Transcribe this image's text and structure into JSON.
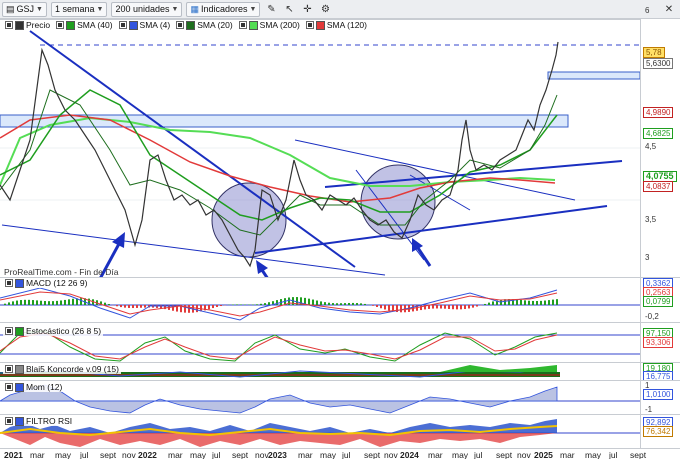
{
  "toolbar": {
    "symbol": "GSJ",
    "period": "1 semana",
    "units": "200 unidades",
    "indicators_label": "Indicadores",
    "legend": [
      {
        "label": "Precio",
        "color": "#333333",
        "checked": true
      },
      {
        "label": "SMA (40)",
        "color": "#1f9e1f",
        "checked": true
      },
      {
        "label": "SMA (4)",
        "color": "#3355dd",
        "checked": true
      },
      {
        "label": "SMA (20)",
        "color": "#1e6e1e",
        "checked": true
      },
      {
        "label": "SMA (200)",
        "color": "#55dd55",
        "checked": true
      },
      {
        "label": "SMA (120)",
        "color": "#e23a3a",
        "checked": true
      }
    ]
  },
  "price_axis": {
    "ticks": [
      "6",
      "4,5",
      "3,5",
      "3"
    ],
    "badges": [
      {
        "text": "5,78",
        "color": "#c07a00",
        "bg": "#ffe066"
      },
      {
        "text": "5,6300",
        "color": "#333333",
        "bg": "#ffffff"
      },
      {
        "text": "4,9890",
        "color": "#c22222",
        "bg": "#ffffff"
      },
      {
        "text": "4,6825",
        "color": "#1f9e1f",
        "bg": "#ffffff"
      },
      {
        "text": "4,0755",
        "color": "#1f9e1f",
        "bg": "#ffffff"
      },
      {
        "text": "4,0837",
        "color": "#c22222",
        "bg": "#ffffff"
      }
    ]
  },
  "watermark": "ProRealTime.com - Fin de Día",
  "panes": [
    {
      "id": "macd",
      "title": "MACD (12 26 9)",
      "ticks": [
        "0,2",
        "-0,2"
      ],
      "badges": [
        {
          "text": "0,3362",
          "color": "#3355dd"
        },
        {
          "text": "0,2563",
          "color": "#e23a3a"
        },
        {
          "text": "0,0799",
          "color": "#1f9e1f"
        }
      ]
    },
    {
      "id": "stoch",
      "title": "Estocástico (26 8 5)",
      "ticks": [],
      "badges": [
        {
          "text": "97,150",
          "color": "#1f9e1f"
        },
        {
          "text": "93,306",
          "color": "#e23a3a"
        }
      ]
    },
    {
      "id": "blai5",
      "title": "Blai5 Koncorde v.09 (15)",
      "ticks": [],
      "badges": [
        {
          "text": "19,180",
          "color": "#1f9e1f"
        },
        {
          "text": "16,775",
          "color": "#3355dd"
        }
      ]
    },
    {
      "id": "mom",
      "title": "Mom (12)",
      "ticks": [
        "1",
        "-1"
      ],
      "badges": [
        {
          "text": "1,0100",
          "color": "#3355dd"
        }
      ]
    },
    {
      "id": "rsi",
      "title": "FILTRO RSI",
      "ticks": [],
      "badges": [
        {
          "text": "92,892",
          "color": "#3355dd"
        },
        {
          "text": "76,342",
          "color": "#c07a00"
        }
      ]
    }
  ],
  "time_axis": [
    {
      "label": "2021",
      "year": true
    },
    {
      "label": "mar",
      "year": false
    },
    {
      "label": "may",
      "year": false
    },
    {
      "label": "jul",
      "year": false
    },
    {
      "label": "sept",
      "year": false
    },
    {
      "label": "nov",
      "year": false
    },
    {
      "label": "2022",
      "year": true
    },
    {
      "label": "mar",
      "year": false
    },
    {
      "label": "may",
      "year": false
    },
    {
      "label": "jul",
      "year": false
    },
    {
      "label": "sept",
      "year": false
    },
    {
      "label": "nov",
      "year": false
    },
    {
      "label": "2023",
      "year": true
    },
    {
      "label": "mar",
      "year": false
    },
    {
      "label": "may",
      "year": false
    },
    {
      "label": "jul",
      "year": false
    },
    {
      "label": "sept",
      "year": false
    },
    {
      "label": "nov",
      "year": false
    },
    {
      "label": "2024",
      "year": true
    },
    {
      "label": "mar",
      "year": false
    },
    {
      "label": "may",
      "year": false
    },
    {
      "label": "jul",
      "year": false
    },
    {
      "label": "sept",
      "year": false
    },
    {
      "label": "nov",
      "year": false
    },
    {
      "label": "2025",
      "year": true
    },
    {
      "label": "mar",
      "year": false
    },
    {
      "label": "may",
      "year": false
    },
    {
      "label": "jul",
      "year": false
    },
    {
      "label": "sept",
      "year": false
    }
  ]
}
